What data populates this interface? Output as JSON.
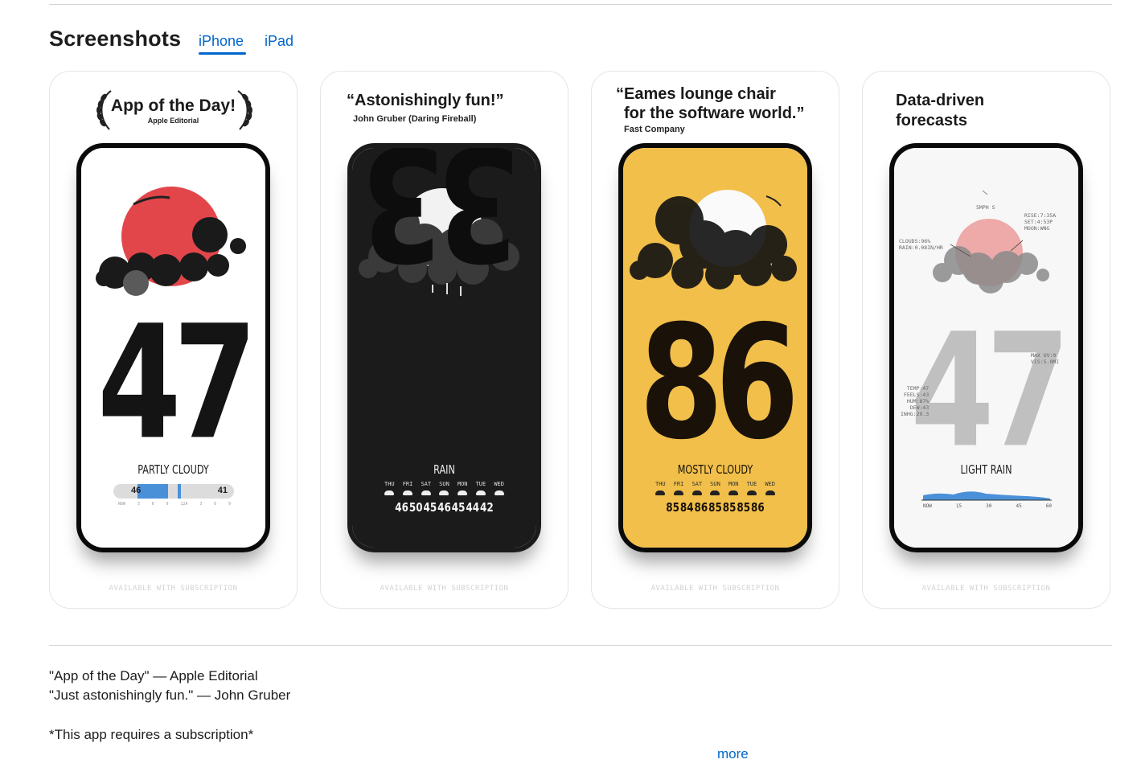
{
  "section": {
    "title": "Screenshots",
    "tabs": [
      {
        "label": "iPhone",
        "selected": true
      },
      {
        "label": "iPad",
        "selected": false
      }
    ]
  },
  "cards": [
    {
      "heading": "App of the Day!",
      "subheading": "Apple Editorial",
      "temperature": "47",
      "condition": "PARTLY CLOUDY",
      "slider_low": "46",
      "slider_high": "41",
      "slider_ticks": [
        "NOW",
        "3",
        "6",
        "9",
        "12A",
        "3",
        "6",
        "9"
      ],
      "footer": "AVAILABLE WITH SUBSCRIPTION"
    },
    {
      "heading": "“Astonishingly fun!”",
      "subheading": "John Gruber (Daring Fireball)",
      "temperature": "33",
      "condition": "RAIN",
      "days": [
        "THU",
        "FRI",
        "SAT",
        "SUN",
        "MON",
        "TUE",
        "WED"
      ],
      "temps": [
        "46",
        "50",
        "45",
        "46",
        "45",
        "44",
        "42"
      ],
      "footer": "AVAILABLE WITH SUBSCRIPTION"
    },
    {
      "heading_line1": "“Eames lounge chair",
      "heading_line2": "for the software world.”",
      "subheading": "Fast Company",
      "temperature": "86",
      "condition": "MOSTLY CLOUDY",
      "days": [
        "THU",
        "FRI",
        "SAT",
        "SUN",
        "MON",
        "TUE",
        "WED"
      ],
      "temps": [
        "85",
        "84",
        "86",
        "85",
        "85",
        "85",
        "86"
      ],
      "footer": "AVAILABLE WITH SUBSCRIPTION"
    },
    {
      "heading_line1": "Data-driven",
      "heading_line2": "forecasts",
      "temperature": "47",
      "condition": "LIGHT RAIN",
      "wind": "5MPH S",
      "sun_info": "RISE:7:35A\nSET:4:53P\nMOON:WNG",
      "cloud_info": "CLOUDS:96%\nRAIN:0.08IN/HR",
      "uv_info": "MAX UV:0\nVIS:5.0MI",
      "temp_info": "TEMP:47\nFEELS:43\nHUM:87%\nDEW:43\nINHG:29.3",
      "chart_ticks": [
        "NOW",
        "15",
        "30",
        "45",
        "60"
      ],
      "footer": "AVAILABLE WITH SUBSCRIPTION"
    }
  ],
  "description": {
    "line1": "\"App of the Day\" — Apple Editorial",
    "line2": "\"Just astonishingly fun.\" — John Gruber",
    "line3": "*This app requires a subscription*",
    "more_label": "more"
  },
  "colors": {
    "accent": "#0066cc",
    "sun_red": "#e2464a",
    "card3_bg": "#f1bf4a",
    "card2_bg": "#1b1b1b",
    "rain_chart": "#4a90d9"
  }
}
